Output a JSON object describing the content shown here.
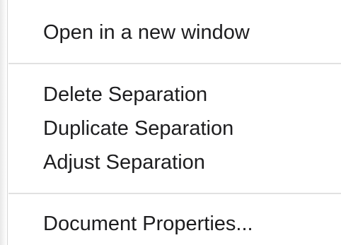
{
  "context_menu": {
    "groups": [
      {
        "items": [
          {
            "label": "Open in a new window"
          }
        ]
      },
      {
        "items": [
          {
            "label": "Delete Separation"
          },
          {
            "label": "Duplicate Separation"
          },
          {
            "label": "Adjust Separation"
          }
        ]
      },
      {
        "items": [
          {
            "label": "Document Properties..."
          }
        ]
      }
    ]
  }
}
